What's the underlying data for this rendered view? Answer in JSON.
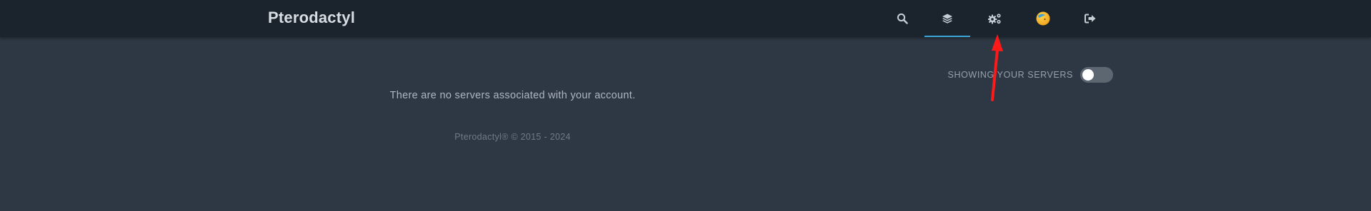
{
  "app": {
    "brand": "Pterodactyl"
  },
  "nav": {
    "items": [
      {
        "name": "search",
        "icon": "search-icon",
        "active": false
      },
      {
        "name": "servers",
        "icon": "layers-icon",
        "active": true
      },
      {
        "name": "admin",
        "icon": "cogs-icon",
        "active": false
      },
      {
        "name": "account",
        "icon": "avatar-icon",
        "active": false
      },
      {
        "name": "logout",
        "icon": "sign-out-icon",
        "active": false
      }
    ],
    "active_color": "#3aa7d8"
  },
  "server_list": {
    "toggle_label": "SHOWING YOUR SERVERS",
    "toggle_on": false,
    "empty_message": "There are no servers associated with your account."
  },
  "footer": {
    "text": "Pterodactyl® © 2015 - 2024"
  },
  "annotation": {
    "color": "#ff1a1a",
    "target": "admin"
  }
}
